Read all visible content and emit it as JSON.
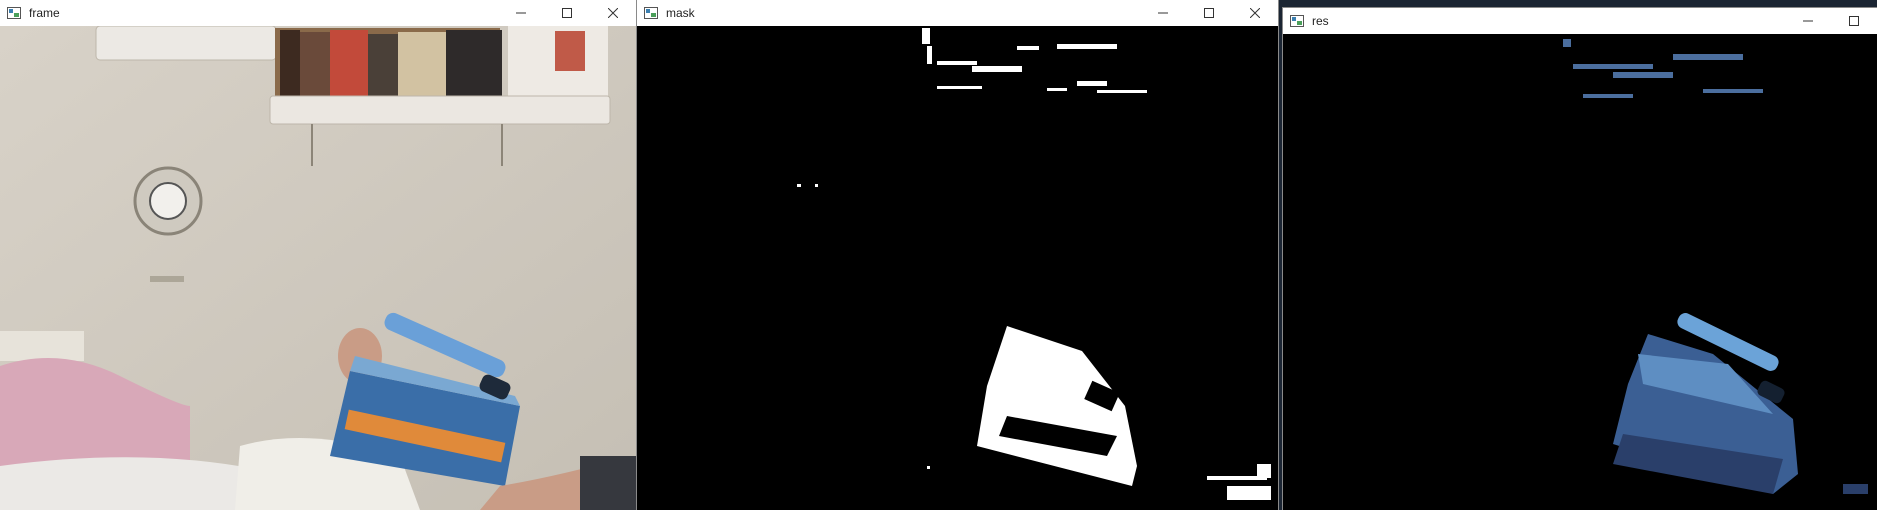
{
  "windows": [
    {
      "title": "frame",
      "icon": "opencv-window-icon"
    },
    {
      "title": "mask",
      "icon": "opencv-window-icon"
    },
    {
      "title": "res",
      "icon": "opencv-window-icon"
    }
  ],
  "controls": {
    "minimize": "minimize-icon",
    "maximize": "maximize-icon",
    "close": "close-icon"
  },
  "colors": {
    "titlebar": "#ffffff",
    "image_background": "#000000",
    "taskbar": "#1b2533"
  }
}
